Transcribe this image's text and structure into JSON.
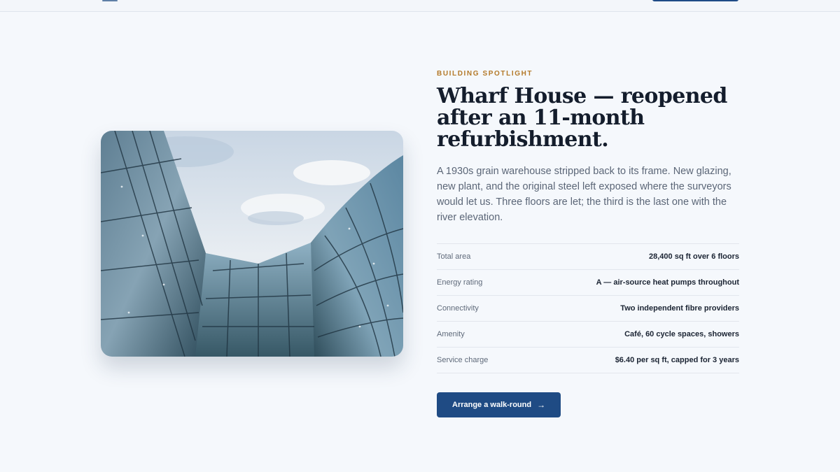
{
  "header": {
    "menu_icon": "menu-icon",
    "cta_color": "#1e4b86"
  },
  "spotlight": {
    "eyebrow": "BUILDING SPOTLIGHT",
    "title": "Wharf House — reopened after an 11-month refurbishment.",
    "description": "A 1930s grain warehouse stripped back to its frame. New glazing, new plant, and the original steel left exposed where the surveyors would let us. Three floors are let; the third is the last one with the river elevation.",
    "specs": [
      {
        "label": "Total area",
        "value": "28,400 sq ft over 6 floors"
      },
      {
        "label": "Energy rating",
        "value": "A — air-source heat pumps throughout"
      },
      {
        "label": "Connectivity",
        "value": "Two independent fibre providers"
      },
      {
        "label": "Amenity",
        "value": "Café, 60 cycle spaces, showers"
      },
      {
        "label": "Service charge",
        "value": "$6.40 per sq ft, capped for 3 years"
      }
    ],
    "cta_label": "Arrange a walk-round",
    "cta_icon": "arrow-right-icon",
    "accent_color": "#b47a2a",
    "button_color": "#1f4b84"
  }
}
